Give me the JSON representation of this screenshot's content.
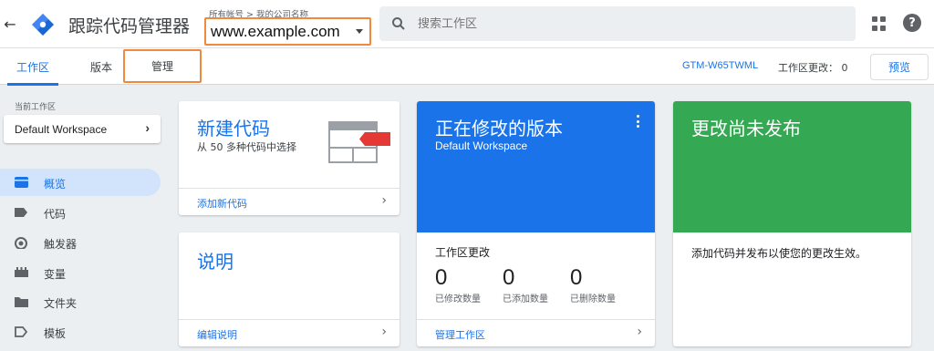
{
  "header": {
    "app_title": "跟踪代码管理器",
    "breadcrumb": "所有帐号 > 我的公司名称",
    "container": "www.example.com",
    "search_placeholder": "搜索工作区"
  },
  "tabs": [
    {
      "label": "工作区",
      "active": true
    },
    {
      "label": "版本",
      "active": false
    },
    {
      "label": "管理",
      "active": false
    }
  ],
  "tabbar_right": {
    "gtm_id": "GTM-W65TWML",
    "workspace_changes": "工作区更改：  0",
    "preview_label": "预览"
  },
  "sidebar": {
    "current_workspace_label": "当前工作区",
    "workspace_name": "Default Workspace",
    "items": [
      {
        "label": "概览",
        "icon": "overview-icon",
        "active": true
      },
      {
        "label": "代码",
        "icon": "tag-icon",
        "active": false
      },
      {
        "label": "触发器",
        "icon": "trigger-icon",
        "active": false
      },
      {
        "label": "变量",
        "icon": "variable-icon",
        "active": false
      },
      {
        "label": "文件夹",
        "icon": "folder-icon",
        "active": false
      },
      {
        "label": "模板",
        "icon": "template-icon",
        "active": false
      }
    ]
  },
  "cards": {
    "new_tag": {
      "title": "新建代码",
      "subtitle": "从 50 多种代码中选择",
      "link": "添加新代码"
    },
    "description": {
      "title": "说明",
      "link": "编辑说明"
    },
    "editing_version": {
      "title": "正在修改的版本",
      "workspace": "Default Workspace",
      "changes_title": "工作区更改",
      "stats": [
        {
          "value": "0",
          "caption": "已修改数量"
        },
        {
          "value": "0",
          "caption": "已添加数量"
        },
        {
          "value": "0",
          "caption": "已删除数量"
        }
      ],
      "link": "管理工作区"
    },
    "unpublished": {
      "title": "更改尚未发布",
      "body": "添加代码并发布以使您的更改生效。"
    }
  },
  "colors": {
    "accent": "#1a73e8",
    "green": "#34a853",
    "highlight_border": "#f0883e",
    "tag_red": "#e53935"
  }
}
